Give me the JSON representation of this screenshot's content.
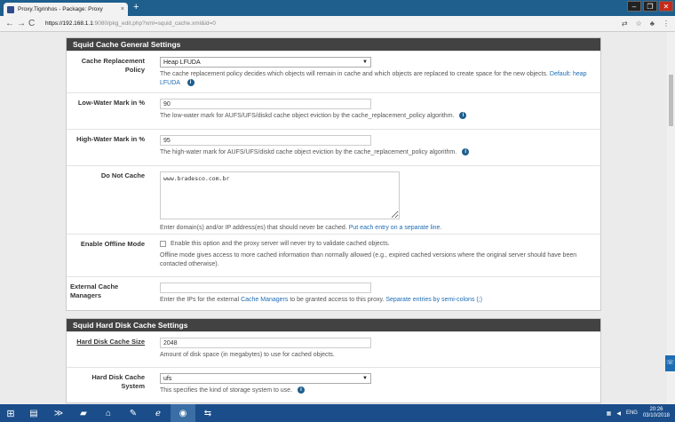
{
  "browser": {
    "tab_title": "Proxy.Tigrinhos - Package: Proxy",
    "tab_close": "×",
    "new_tab": "+",
    "url_host": "https://192.168.1.1",
    "url_path": ":9080/pkg_edit.php?xml=squid_cache.xml&id=0",
    "back": "←",
    "forward": "→",
    "reload": "C"
  },
  "general": {
    "heading": "Squid Cache General Settings",
    "replacement": {
      "label": "Cache Replacement Policy",
      "value": "Heap LFUDA",
      "help": "The cache replacement policy decides which objects will remain in cache and which objects are replaced to create space for the new objects.",
      "help_default": "Default: heap LFUDA"
    },
    "low_water": {
      "label": "Low-Water Mark in %",
      "value": "90",
      "help": "The low-water mark for AUFS/UFS/diskd cache object eviction by the cache_replacement_policy algorithm."
    },
    "high_water": {
      "label": "High-Water Mark in %",
      "value": "95",
      "help": "The high-water mark for AUFS/UFS/diskd cache object eviction by the cache_replacement_policy algorithm."
    },
    "do_not_cache": {
      "label": "Do Not Cache",
      "value": "www.bradesco.com.br",
      "help": "Enter domain(s) and/or IP address(es) that should never be cached.",
      "help_link": "Put each entry on a separate line."
    },
    "offline": {
      "label": "Enable Offline Mode",
      "checkbox_text": "Enable this option and the proxy server will never try to validate cached objects.",
      "help": "Offline mode gives access to more cached information than normally allowed (e.g., expired cached versions where the original server should have been contacted otherwise)."
    },
    "ext_managers": {
      "label": "External Cache Managers",
      "value": "",
      "help_pre": "Enter the IPs for the external",
      "help_link1": "Cache Managers",
      "help_mid": "to be granted access to this proxy.",
      "help_link2": "Separate entries by semi-colons (;)"
    }
  },
  "hdd": {
    "heading": "Squid Hard Disk Cache Settings",
    "size": {
      "label": "Hard Disk Cache Size",
      "value": "2048",
      "help": "Amount of disk space (in megabytes) to use for cached objects."
    },
    "system": {
      "label": "Hard Disk Cache System",
      "value": "ufs",
      "help": "This specifies the kind of storage system to use."
    }
  },
  "taskbar": {
    "lang": "ENG",
    "time": "20:26",
    "date": "03/10/2018"
  }
}
